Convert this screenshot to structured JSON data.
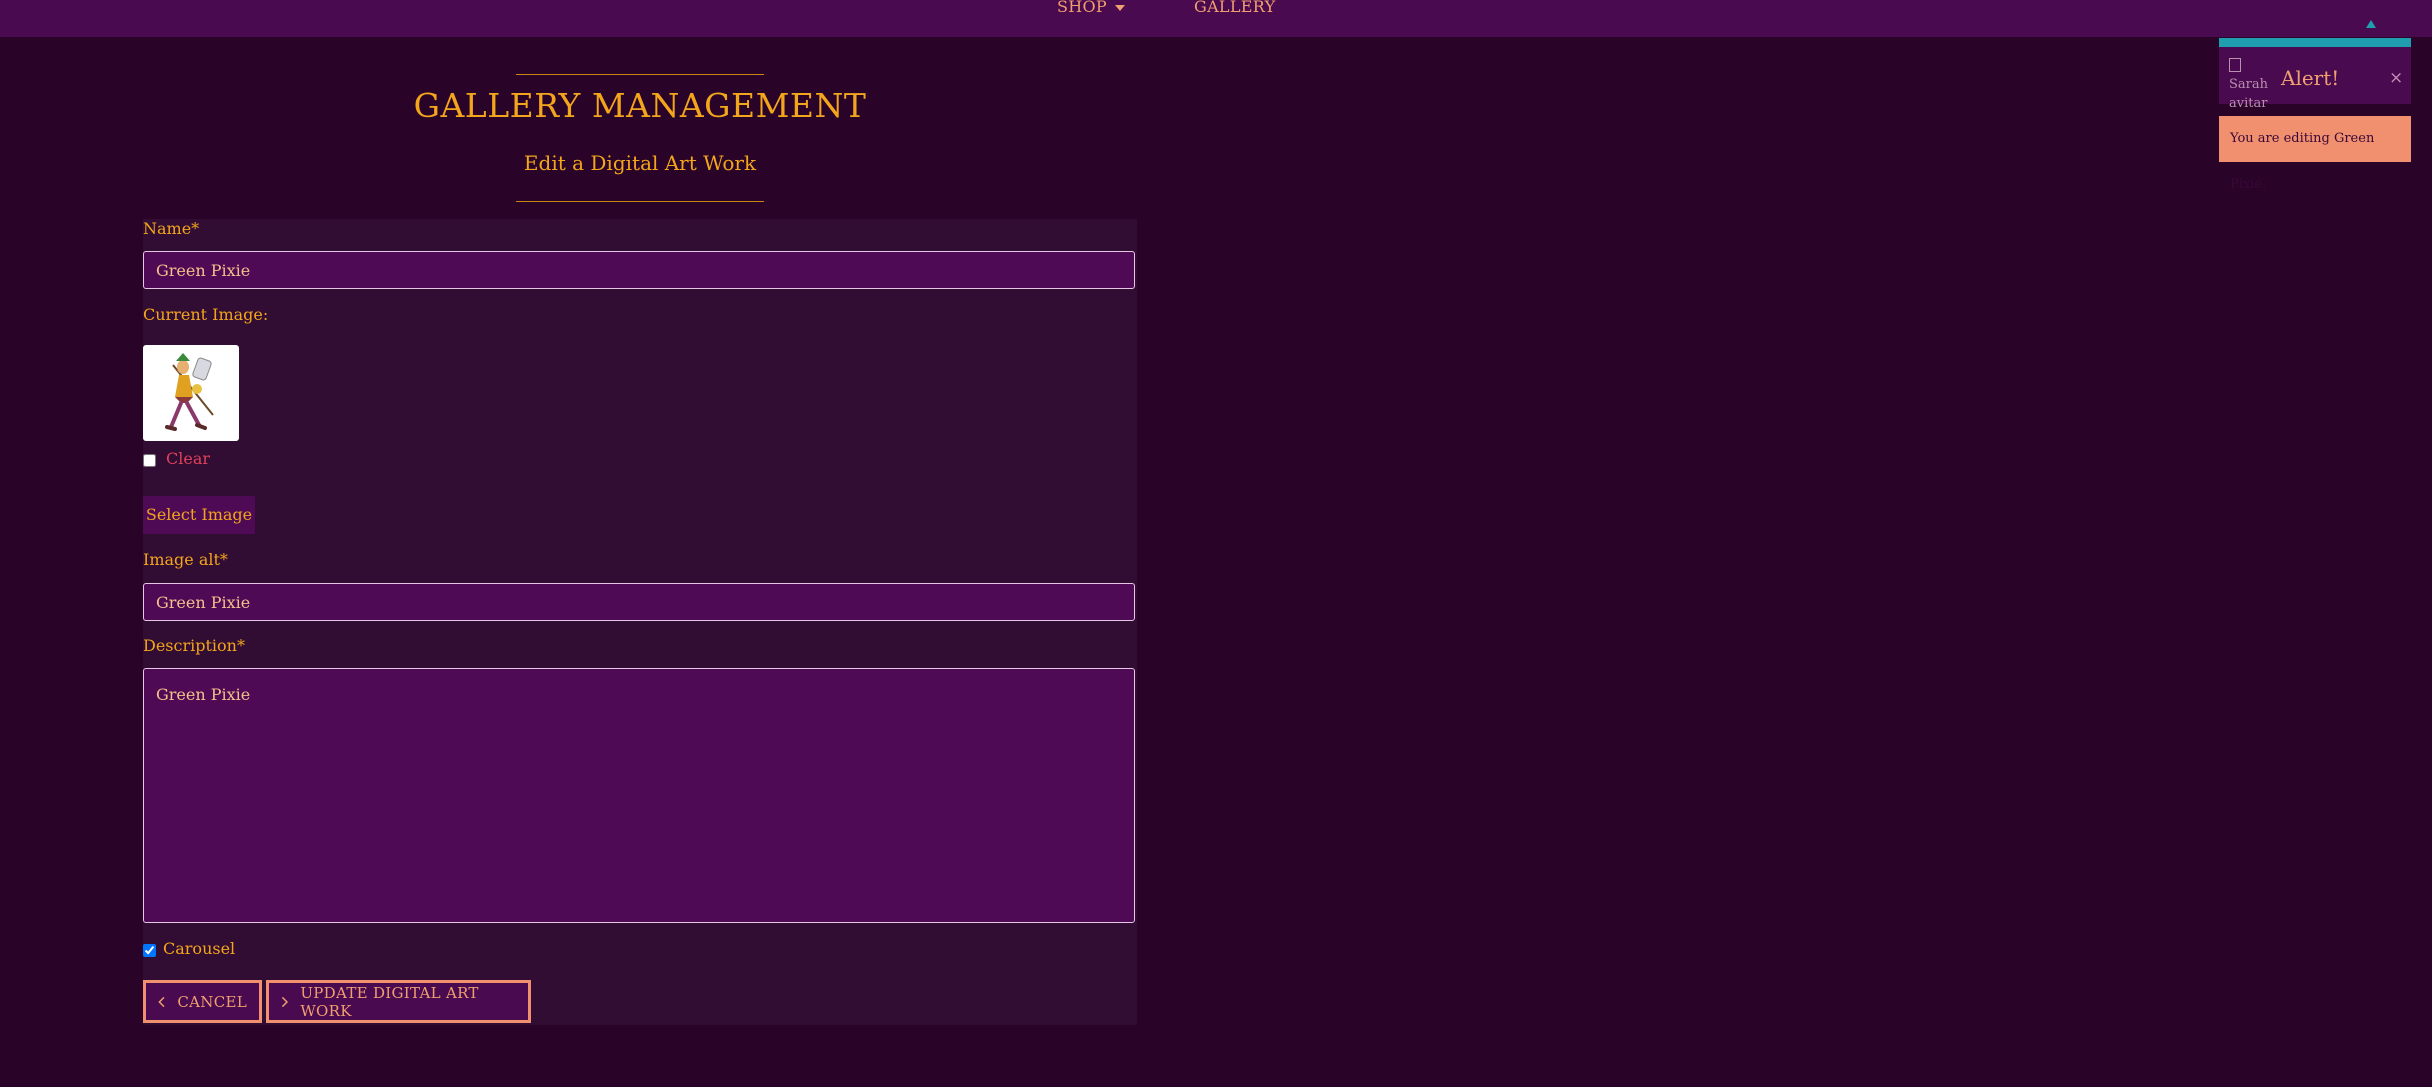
{
  "nav": {
    "shop_label": "SHOP",
    "gallery_label": "GALLERY"
  },
  "header": {
    "title": "GALLERY MANAGEMENT",
    "subtitle": "Edit a Digital Art Work"
  },
  "form": {
    "name_label": "Name*",
    "name_value": "Green Pixie",
    "current_image_label": "Current Image:",
    "current_image_alt": "Green Pixie",
    "clear_label": "Clear",
    "clear_checked": false,
    "select_image_label": "Select Image",
    "image_alt_label": "Image alt*",
    "image_alt_value": "Green Pixie",
    "description_label": "Description*",
    "description_value": "Green Pixie",
    "carousel_label": "Carousel",
    "carousel_checked": true,
    "cancel_label": "CANCEL",
    "update_label": "UPDATE DIGITAL ART WORK"
  },
  "toast": {
    "avatar_alt": "Sarah avitar",
    "title": "Alert!",
    "close_symbol": "×",
    "message": "You are editing Green Pixie."
  },
  "icons": {
    "cancel": "chevron-left-icon",
    "update": "chevron-right-icon",
    "shop_dropdown": "caret-down-icon",
    "toast_close": "close-icon"
  },
  "colors": {
    "background": "#290428",
    "nav_background": "#4a0a4f",
    "accent_gold": "#f3a51b",
    "accent_salmon": "#f0906e",
    "toast_teal": "#1e9eae",
    "input_background": "#4e0a55",
    "clear_red": "#e0405a"
  }
}
